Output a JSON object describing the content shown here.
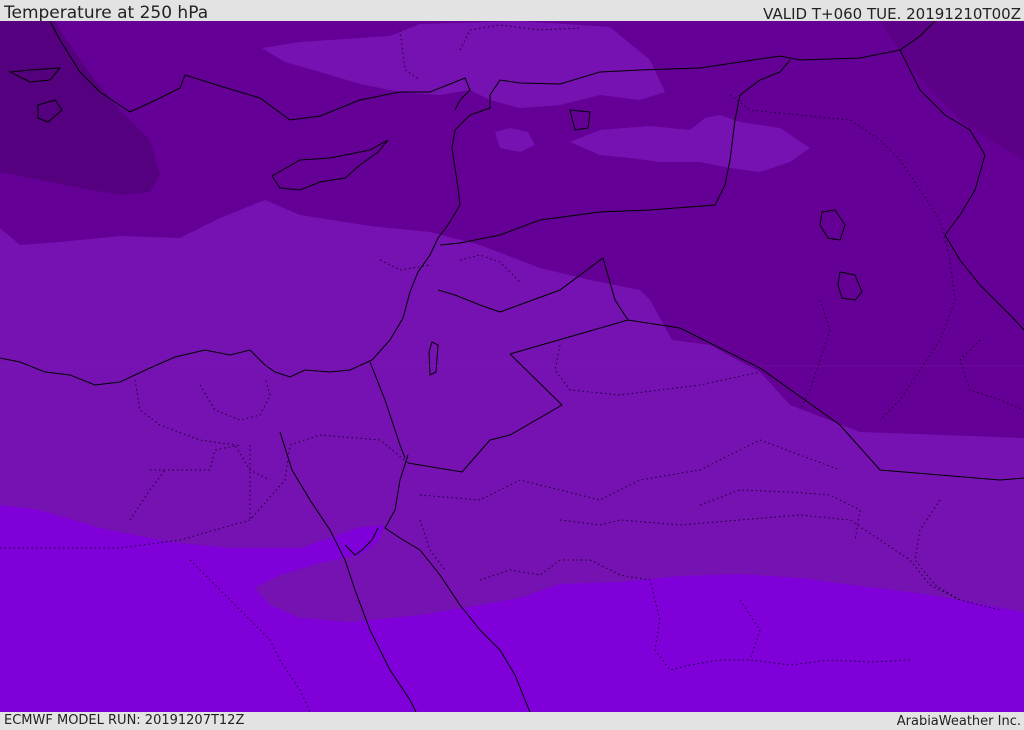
{
  "header": {
    "title": "Temperature at 250 hPa",
    "valid": "VALID T+060 TUE. 20191210T00Z"
  },
  "footer": {
    "model_run": "ECMWF MODEL RUN: 20191207T12Z",
    "brand": "ArabiaWeather Inc."
  },
  "colors": {
    "band_darkest": "#55007f",
    "band_dark": "#650096",
    "band_mid": "#7612b1",
    "band_light": "#7f00d9",
    "coastline": "#000000",
    "border_dotted": "#1a0033"
  }
}
